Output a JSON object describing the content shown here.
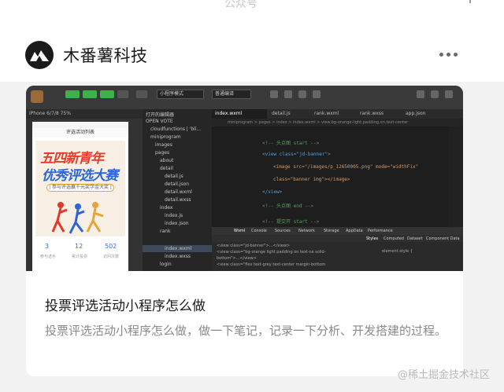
{
  "header": {
    "top_caption": "公众号",
    "account_name": "木番薯科技",
    "more_icon": "more-icon"
  },
  "card": {
    "title": "投票评选活动小程序怎么做",
    "description": "投票评选活动小程序怎么做，做一下笔记，记录一下分析、开发搭建的过程。"
  },
  "screenshot": {
    "editor_tabs": [
      "index.wxml",
      "detail.js",
      "rank.wxml",
      "rank.wxss",
      "app.json"
    ],
    "breadcrumb": "miniprogram > pages > index > index.wxml > view.bg-orange.light.padding.on.text-center",
    "code": [
      "<!-- 头点图 start -->",
      "<view class=\"jd-banner\">",
      "<image src=\"/images/p_12650005.png\" mode=\"widthFix\"",
      "class=\"banner img\"></image>",
      "</view>",
      "<!-- 头点图 end -->",
      "<!-- 提交开 start -->"
    ],
    "tree_items": [
      "打开的编辑器",
      "OPEN VOTE",
      "cloudfunctions | 'bli...",
      "miniprogram",
      "images",
      "pages",
      "about",
      "detail",
      "detail.js",
      "detail.json",
      "detail.wxml",
      "detail.wxss",
      "index",
      "index.js",
      "index.json",
      "index.wxml",
      "index.wxss",
      "login",
      "rank"
    ],
    "devtools_tabs": [
      "Wxml",
      "Console",
      "Sources",
      "Network",
      "Storage",
      "AppData",
      "Performance"
    ],
    "devtools_right": [
      "Styles",
      "Computed",
      "Dataset",
      "Component Data"
    ],
    "devtools_lines": [
      "<view class=\"jd-banner\">...</view>",
      "<view class=\"bg-orange light padding on text-ce solid-",
      "bottom\">...</view>",
      "<view class=\"flex text-grey text-center margin-bottom"
    ],
    "style_line": "element.style {",
    "phone_nav_title": "评选活动列表",
    "banner_line1": "五四新青年",
    "banner_line2": "优秀评选大赛",
    "banner_line3": "| 参与评选赢千元奖学金大奖 |",
    "stats": [
      {
        "value": "3",
        "label": "参与选手"
      },
      {
        "value": "12",
        "label": "累计投票"
      },
      {
        "value": "502",
        "label": "访问次数"
      }
    ],
    "sim_label": "iPhone 6/7/8 75%",
    "select_label_1": "小程序模式",
    "select_label_2": "普通编译"
  },
  "watermark": "@稀土掘金技术社区"
}
